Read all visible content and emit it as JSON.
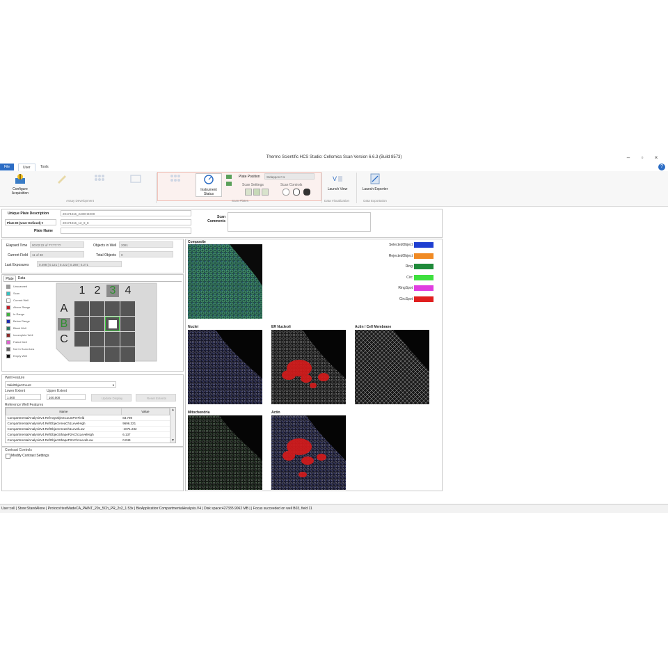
{
  "window": {
    "title": "Thermo Scientific HCS Studio: Cellomics Scan Version 6.6.3 (Build 8573)",
    "minimize": "–",
    "maximize": "▫",
    "close": "×",
    "help": "?"
  },
  "tabs": [
    {
      "label": "File"
    },
    {
      "label": "User"
    },
    {
      "label": "Tools"
    }
  ],
  "ribbon": {
    "configure": "Configure Acquisition",
    "dis1": "",
    "dis2": "",
    "dis3": "",
    "grp_assay": "Assay Development",
    "scan_btn": "",
    "instrument_status": "Instrument Status",
    "plate_position_label": "Plate Position",
    "plate_position_value": "Stdappos 0 ▾",
    "scan_settings_label": "Scan Settings",
    "scan_controls_label": "Scan Controls",
    "grp_scan": "Scan Plates",
    "launch_view": "Launch View",
    "grp_data_vis": "Data Visualization",
    "launch_exporter": "Launch Exporter",
    "grp_data_exp": "Data Exportation"
  },
  "plate_info": {
    "unique_desc_label": "Unique Plate Description",
    "unique_desc_value": "20174316_2400H2X00",
    "plate_id_label": "Plate ID (User Defined) ▾",
    "plate_id_value": "20174316_12_9_8",
    "plate_name_label": "Plate Name",
    "scan_comments_label": "Scan Comments"
  },
  "stats": {
    "elapsed_label": "Elapsed Time",
    "elapsed_value": "00:02:22 of ??:??:??",
    "objects_well_label": "Objects in Well",
    "objects_well_value": "2081",
    "current_field_label": "Current Field",
    "current_field_value": "11 of 30",
    "total_objects_label": "Total Objects",
    "total_objects_value": "0",
    "last_exposure_label": "Last Exposures",
    "last_exposure_value": "0.498 | 0.121 | 0.222 | 0.288 | 0.271"
  },
  "plate_tabs": [
    {
      "label": "Plate"
    },
    {
      "label": "Data"
    }
  ],
  "plate_legend": [
    {
      "label": "Unscanned",
      "color": "#9a9a9a"
    },
    {
      "label": "Scan",
      "color": "#36c2c2"
    },
    {
      "label": "Current Well",
      "color": "#ffffff"
    },
    {
      "label": "Above Range",
      "color": "#c0202a"
    },
    {
      "label": "In Range",
      "color": "#3fb23f"
    },
    {
      "label": "Below Range",
      "color": "#1d2bb0"
    },
    {
      "label": "Blank Well",
      "color": "#2a7a60"
    },
    {
      "label": "Incomplete Well",
      "color": "#8b2a2a"
    },
    {
      "label": "Failed Well",
      "color": "#e060d0"
    },
    {
      "label": "Not In Scan Area",
      "color": "#666666"
    },
    {
      "label": "Empty Well",
      "color": "#111111"
    }
  ],
  "plate_map": {
    "cols": [
      "1",
      "2",
      "3",
      "4"
    ],
    "rows": [
      "A",
      "B",
      "C"
    ]
  },
  "well_feature": {
    "section_label": "Well Feature",
    "dropdown_value": "ValidObjectCount",
    "lower_label": "Lower Extent",
    "lower_value": "1.000",
    "upper_label": "Upper Extent",
    "upper_value": "100.000",
    "update_btn": "Update Display",
    "reset_btn": "Reset Extents"
  },
  "reference": {
    "label": "Reference Well Features",
    "header_name": "Name",
    "header_value": "Value",
    "rows": [
      {
        "name": "CompartmentalAnalysisV4.RefAvgObjectCountPerField",
        "value": "83.798"
      },
      {
        "name": "CompartmentalAnalysisV4.RefObjectAreaCh1LevelHigh",
        "value": "9696.321"
      },
      {
        "name": "CompartmentalAnalysisV4.RefObjectAreaCh1LevelLow",
        "value": "-4071.232"
      },
      {
        "name": "CompartmentalAnalysisV4.RefObjectShapeP2ACh1LevelHigh",
        "value": "6.137"
      },
      {
        "name": "CompartmentalAnalysisV4.RefObjectShapeP2ACh1LevelLow",
        "value": "0.049"
      }
    ]
  },
  "contrast": {
    "label": "Contrast Controls",
    "checkbox": "Modify Contrast Settings"
  },
  "images": {
    "composite": "Composite",
    "nuclei": "Nuclei",
    "er": "ER Nucleoli",
    "actin_cm": "Actin / Cell Membrane",
    "mito": "Mitochondria",
    "actin": "Actin"
  },
  "overlay_legend": [
    {
      "label": "SelectedObject",
      "color": "#1f3fd1"
    },
    {
      "label": "RejectedObject",
      "color": "#f08a24"
    },
    {
      "label": "Ring",
      "color": "#1f8a3a"
    },
    {
      "label": "Circ",
      "color": "#3ee03e"
    },
    {
      "label": "RingSpot",
      "color": "#e03ee0"
    },
    {
      "label": "CircSpot",
      "color": "#e01f1f"
    }
  ],
  "status_bar": "User:cell  |  Store:StandAlone  |  Protocol:testMadeCA_PAINT_20x_5Ch_PR_2x2_1.53x  |  BioApplication:CompartmentalAnalysis.V4  |  Disk space:427335.9062 MB  |  |  Focus succeeded on well B03, field 11"
}
